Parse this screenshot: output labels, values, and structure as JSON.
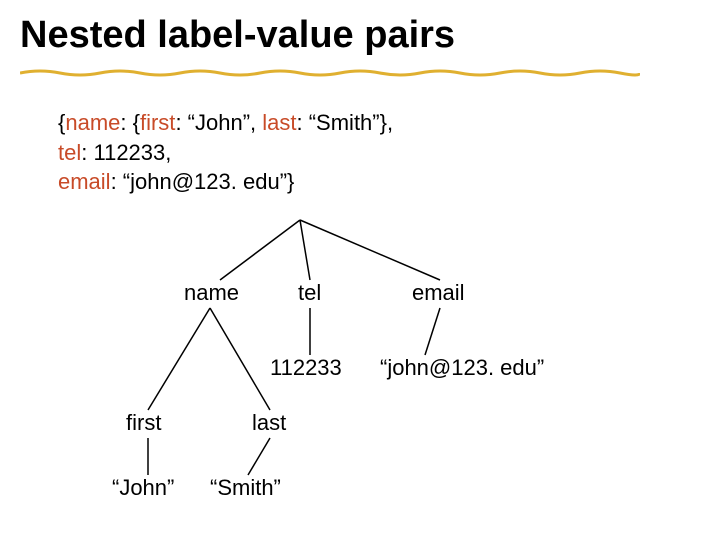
{
  "title": "Nested label-value pairs",
  "code": {
    "line1": {
      "open": "{",
      "k1": "name",
      "sep1": ": {",
      "k2": "first",
      "sep2": ": “John”, ",
      "k3": "last",
      "sep3": ": “Smith”},"
    },
    "line2": {
      "pad": " ",
      "k": "tel",
      "rest": ": 112233,"
    },
    "line3": {
      "k": "email",
      "rest": ": “john@123. edu”}"
    }
  },
  "tree": {
    "name": "name",
    "tel": "tel",
    "email": "email",
    "tel_val": "112233",
    "email_val": "“john@123. edu”",
    "first": "first",
    "last": "last",
    "first_val": "“John”",
    "last_val": "“Smith”"
  },
  "colors": {
    "label": "#c84b28",
    "underline": "#e0b030"
  }
}
